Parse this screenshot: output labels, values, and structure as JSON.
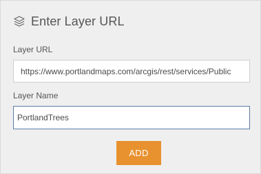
{
  "header": {
    "title": "Enter Layer URL",
    "icon": "layers-icon"
  },
  "layer_url": {
    "label": "Layer URL",
    "value": "https://www.portlandmaps.com/arcgis/rest/services/Public"
  },
  "layer_name": {
    "label": "Layer Name",
    "value": "PortlandTrees"
  },
  "add_button": {
    "label": "ADD",
    "color": "#e8912f"
  },
  "colors": {
    "panel_background": "#efefef",
    "focus_border": "#5a7ea6"
  }
}
